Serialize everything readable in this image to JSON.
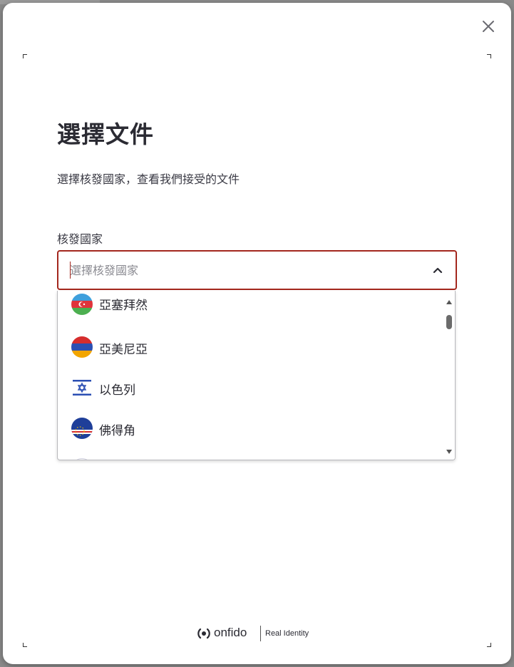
{
  "modal": {
    "title": "選擇文件",
    "subtitle": "選擇核發國家，查看我們接受的文件",
    "field_label": "核發國家",
    "select": {
      "placeholder": "選擇核發國家",
      "value": "",
      "expanded": true
    },
    "options": [
      {
        "label": "亞塞拜然",
        "flag": "azerbaijan-flag-icon"
      },
      {
        "label": "亞美尼亞",
        "flag": "armenia-flag-icon"
      },
      {
        "label": "以色列",
        "flag": "israel-flag-icon"
      },
      {
        "label": "佛得角",
        "flag": "cape-verde-flag-icon"
      }
    ],
    "close_icon": "close-icon"
  },
  "footer": {
    "brand": "onfido",
    "tagline": "Real Identity"
  },
  "colors": {
    "focus_border": "#a3271d",
    "text_primary": "#2b2b33",
    "placeholder": "#8b8b92"
  }
}
